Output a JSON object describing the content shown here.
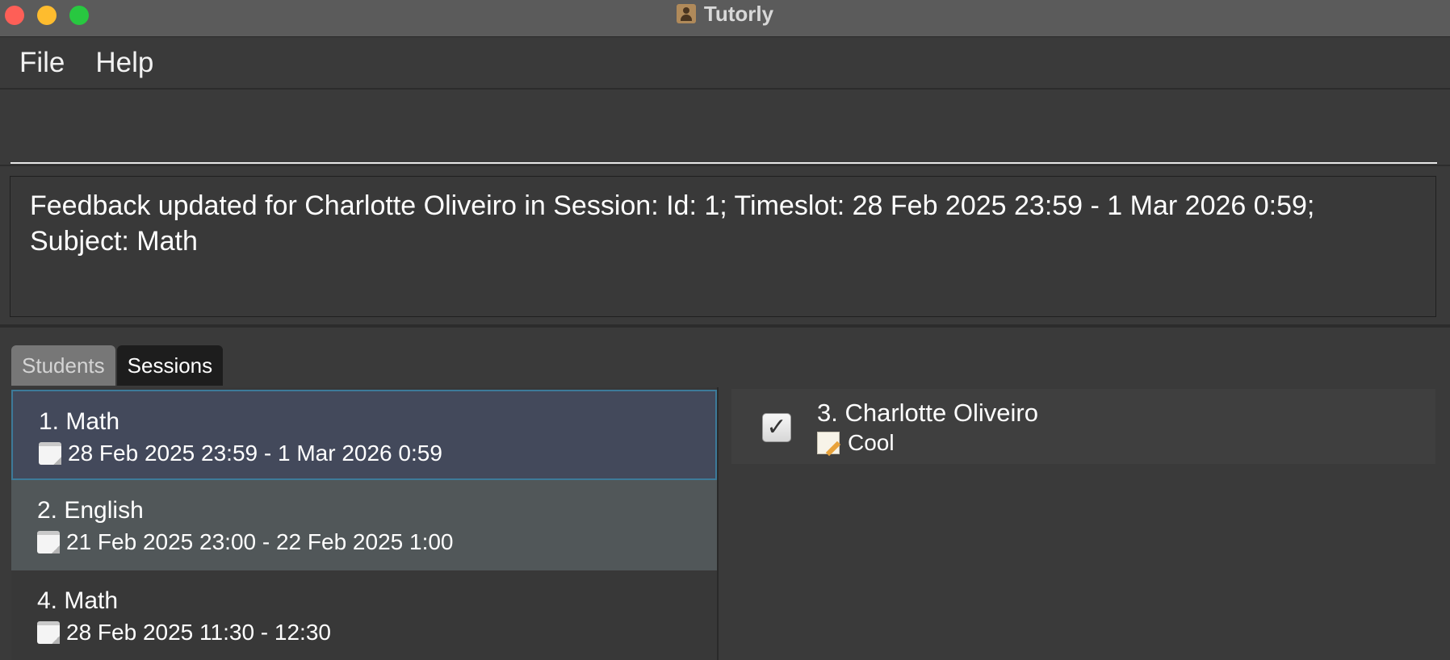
{
  "window": {
    "title": "Tutorly"
  },
  "menu": {
    "items": [
      "File",
      "Help"
    ]
  },
  "command": {
    "value": "",
    "placeholder": ""
  },
  "result": {
    "text": "Feedback updated for Charlotte Oliveiro in Session: Id: 1; Timeslot: 28 Feb 2025 23:59 - 1 Mar 2026 0:59; Subject: Math"
  },
  "tabs": [
    {
      "label": "Students"
    },
    {
      "label": "Sessions"
    }
  ],
  "sessions": [
    {
      "title": "1. Math",
      "time": "28 Feb 2025 23:59 - 1 Mar 2026 0:59",
      "icon": "calendar-icon"
    },
    {
      "title": "2. English",
      "time": "21 Feb 2025 23:00 - 22 Feb 2025 1:00",
      "icon": "calendar-icon"
    },
    {
      "title": "4. Math",
      "time": "28 Feb 2025 11:30 - 12:30",
      "icon": "calendar-icon"
    }
  ],
  "attendance": [
    {
      "name": "3. Charlotte Oliveiro",
      "feedback": "Cool",
      "checked": true,
      "icon": "memo-icon"
    }
  ],
  "colors": {
    "accent_border": "#3d7a99",
    "selected_bg": "#43495b",
    "close": "#fe5f57",
    "minimize": "#febc2e",
    "maximize": "#28c840"
  }
}
